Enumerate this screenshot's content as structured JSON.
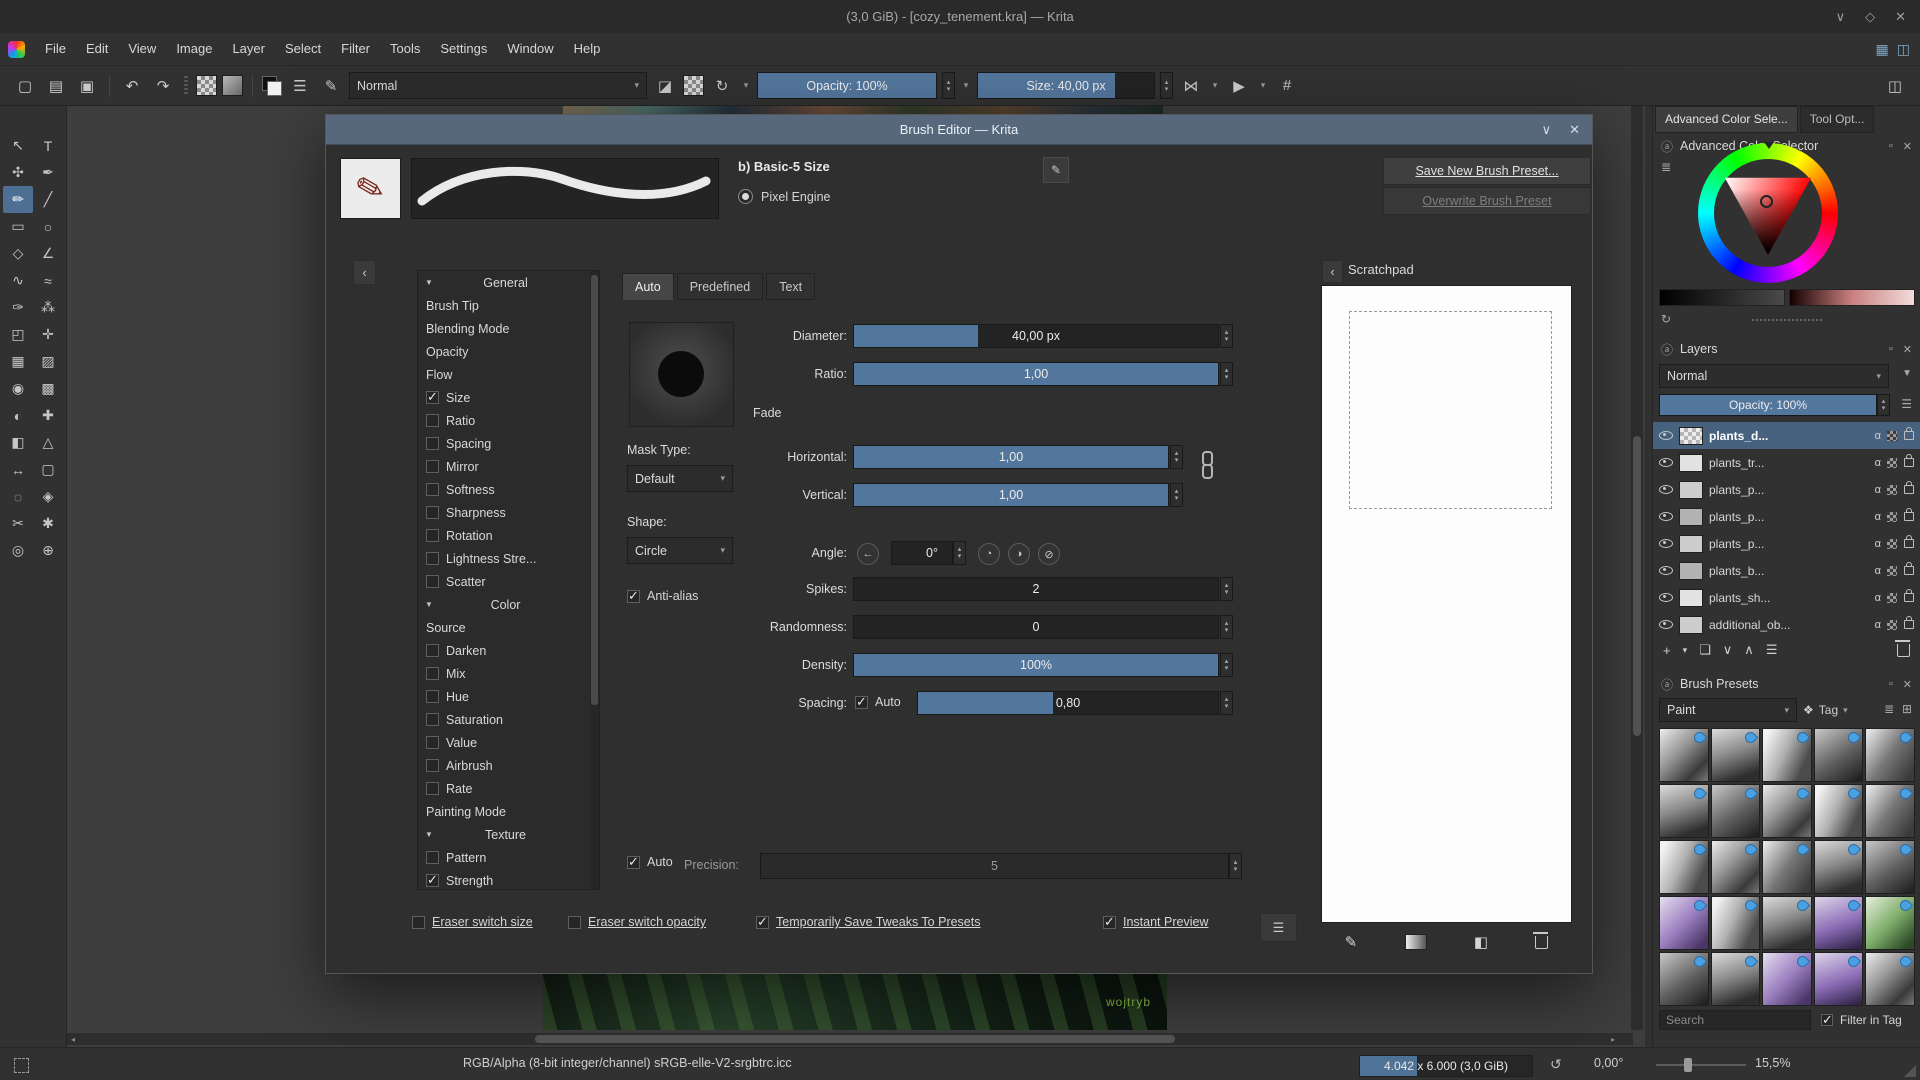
{
  "window": {
    "title": "(3,0 GiB) - [cozy_tenement.kra] — Krita"
  },
  "icons": {
    "minimize": "∨",
    "maximize": "◇",
    "close": "✕",
    "new": "▢",
    "open": "▤",
    "save": "▣",
    "undo": "↶",
    "redo": "↷",
    "eraser": "◪",
    "reload": "↻",
    "mirror_h": "⋈",
    "mirror_v": "▶",
    "crop": "#",
    "panel": "◫",
    "workspace_a": "▦",
    "workspace_b": "◫",
    "collapse": "‹",
    "edit": "✎",
    "menu": "☰",
    "brush": "✎",
    "angle_dial": "←",
    "angle_a": "◔",
    "angle_b": "◑",
    "angle_c": "⊘",
    "badge": "ⓐ",
    "float": "▫",
    "dock_close": "✕",
    "refresh": "↻",
    "funnel": "▼",
    "list": "≣",
    "grid": "⊞",
    "tag": "❖",
    "add": "+",
    "caret": "▾",
    "duplicate": "❏",
    "down": "∨",
    "up": "∧",
    "props": "☰",
    "scratch_fill": "◧",
    "rotation": "↺",
    "alpha": "α",
    "left": "◂",
    "right": "▸",
    "up_s": "▴",
    "down_s": "▾"
  },
  "menubar": {
    "items": [
      "File",
      "Edit",
      "View",
      "Image",
      "Layer",
      "Select",
      "Filter",
      "Tools",
      "Settings",
      "Window",
      "Help"
    ]
  },
  "toolbar": {
    "blending_mode": "Normal",
    "opacity_label": "Opacity: 100%",
    "opacity_fill": 100,
    "size_label": "Size: 40,00 px",
    "size_fill": 78
  },
  "toolbox": {
    "tools": [
      {
        "name": "tool-select-shapes",
        "glyph": "↖",
        "state": "off"
      },
      {
        "name": "tool-text",
        "glyph": "T",
        "state": "off"
      },
      {
        "name": "tool-edit-shapes",
        "glyph": "✣",
        "state": "off"
      },
      {
        "name": "tool-calligraphy",
        "glyph": "✒",
        "state": "off"
      },
      {
        "name": "tool-freehand-brush",
        "glyph": "✏",
        "state": "on"
      },
      {
        "name": "tool-line",
        "glyph": "╱",
        "state": "off"
      },
      {
        "name": "tool-rectangle",
        "glyph": "▭",
        "state": "off"
      },
      {
        "name": "tool-ellipse",
        "glyph": "○",
        "state": "off"
      },
      {
        "name": "tool-polygon",
        "glyph": "◇",
        "state": "off"
      },
      {
        "name": "tool-polyline",
        "glyph": "∠",
        "state": "off"
      },
      {
        "name": "tool-bezier-curve",
        "glyph": "∿",
        "state": "off"
      },
      {
        "name": "tool-freehand-path",
        "glyph": "≈",
        "state": "off"
      },
      {
        "name": "tool-dynamic-brush",
        "glyph": "✑",
        "state": "off"
      },
      {
        "name": "tool-multibrush",
        "glyph": "⁂",
        "state": "off"
      },
      {
        "name": "tool-transform",
        "glyph": "◰",
        "state": "off"
      },
      {
        "name": "tool-move",
        "glyph": "✛",
        "state": "off"
      },
      {
        "name": "tool-crop",
        "glyph": "▦",
        "state": "off"
      },
      {
        "name": "tool-gradient",
        "glyph": "▨",
        "state": "off"
      },
      {
        "name": "tool-color-sampler",
        "glyph": "◉",
        "state": "off"
      },
      {
        "name": "tool-pattern",
        "glyph": "▩",
        "state": "off"
      },
      {
        "name": "tool-colorize-mask",
        "glyph": "◐",
        "state": "off"
      },
      {
        "name": "tool-smart-patch",
        "glyph": "✚",
        "state": "off"
      },
      {
        "name": "tool-fill",
        "glyph": "◧",
        "state": "off"
      },
      {
        "name": "tool-assistants",
        "glyph": "△",
        "state": "off"
      },
      {
        "name": "tool-measure",
        "glyph": "↔",
        "state": "off"
      },
      {
        "name": "tool-rect-select",
        "glyph": "▢",
        "state": "off"
      },
      {
        "name": "tool-ellipse-select",
        "glyph": "◌",
        "state": "off"
      },
      {
        "name": "tool-polygon-select",
        "glyph": "◈",
        "state": "off"
      },
      {
        "name": "tool-freehand-select",
        "glyph": "✂",
        "state": "off"
      },
      {
        "name": "tool-contiguous-select",
        "glyph": "✱",
        "state": "off"
      },
      {
        "name": "tool-zoom",
        "glyph": "◎",
        "state": "off"
      },
      {
        "name": "tool-pan",
        "glyph": "⊕",
        "state": "off"
      }
    ]
  },
  "canvas": {
    "signature": "wojtryb"
  },
  "dialog": {
    "title": "Brush Editor — Krita",
    "preset_name": "b) Basic-5 Size",
    "engine_label": "Pixel Engine",
    "save_button": "Save New Brush Preset...",
    "overwrite_button": "Overwrite Brush Preset",
    "options": [
      {
        "type": "header",
        "label": "General"
      },
      {
        "type": "plain",
        "label": "Brush Tip"
      },
      {
        "type": "plain",
        "label": "Blending Mode"
      },
      {
        "type": "plain",
        "label": "Opacity"
      },
      {
        "type": "plain",
        "label": "Flow"
      },
      {
        "type": "check",
        "state": "on",
        "label": "Size"
      },
      {
        "type": "check",
        "state": "off",
        "label": "Ratio"
      },
      {
        "type": "check",
        "state": "off",
        "label": "Spacing"
      },
      {
        "type": "check",
        "state": "off",
        "label": "Mirror"
      },
      {
        "type": "check",
        "state": "off",
        "label": "Softness"
      },
      {
        "type": "check",
        "state": "off",
        "label": "Sharpness"
      },
      {
        "type": "check",
        "state": "off",
        "label": "Rotation"
      },
      {
        "type": "check",
        "state": "off",
        "label": "Lightness Stre..."
      },
      {
        "type": "check",
        "state": "off",
        "label": "Scatter"
      },
      {
        "type": "header",
        "label": "Color"
      },
      {
        "type": "plain",
        "label": "Source"
      },
      {
        "type": "check",
        "state": "off",
        "label": "Darken"
      },
      {
        "type": "check",
        "state": "off",
        "label": "Mix"
      },
      {
        "type": "check",
        "state": "off",
        "label": "Hue"
      },
      {
        "type": "check",
        "state": "off",
        "label": "Saturation"
      },
      {
        "type": "check",
        "state": "off",
        "label": "Value"
      },
      {
        "type": "check",
        "state": "off",
        "label": "Airbrush"
      },
      {
        "type": "check",
        "state": "off",
        "label": "Rate"
      },
      {
        "type": "plain",
        "label": "Painting Mode"
      },
      {
        "type": "header",
        "label": "Texture"
      },
      {
        "type": "check",
        "state": "off",
        "label": "Pattern"
      },
      {
        "type": "check",
        "state": "on",
        "label": "Strength"
      }
    ],
    "tabs": [
      {
        "label": "Auto",
        "state": "on"
      },
      {
        "label": "Predefined",
        "state": "off"
      },
      {
        "label": "Text",
        "state": "off"
      }
    ],
    "fade_label": "Fade",
    "mask_type_label": "Mask Type:",
    "mask_type_value": "Default",
    "shape_label": "Shape:",
    "shape_value": "Circle",
    "angle_label": "Angle:",
    "angle_value": "0°",
    "antialias": {
      "label": "Anti-alias",
      "state": "on"
    },
    "sliders": {
      "diameter": {
        "label": "Diameter:",
        "value": "40,00 px",
        "fill": 34
      },
      "ratio": {
        "label": "Ratio:",
        "value": "1,00",
        "fill": 100
      },
      "horizontal": {
        "label": "Horizontal:",
        "value": "1,00",
        "fill": 100
      },
      "vertical": {
        "label": "Vertical:",
        "value": "1,00",
        "fill": 100
      },
      "spikes": {
        "label": "Spikes:",
        "value": "2",
        "fill": 0
      },
      "randomness": {
        "label": "Randomness:",
        "value": "0",
        "fill": 0
      },
      "density": {
        "label": "Density:",
        "value": "100%",
        "fill": 100
      },
      "spacing": {
        "label": "Spacing:",
        "value": "0,80",
        "fill": 45
      }
    },
    "spacing_auto": {
      "label": "Auto",
      "state": "on"
    },
    "auto_bottom": {
      "label": "Auto",
      "state": "on"
    },
    "precision_label": "Precision:",
    "precision_value": "5",
    "footer": [
      {
        "label": "Eraser switch size",
        "state": "off"
      },
      {
        "label": "Eraser switch opacity",
        "state": "off"
      },
      {
        "label": "Temporarily Save Tweaks To Presets",
        "state": "on"
      },
      {
        "label": "Instant Preview",
        "state": "on"
      }
    ],
    "scratchpad_title": "Scratchpad"
  },
  "docker": {
    "tabs": [
      {
        "label": "Advanced Color Sele...",
        "state": "on"
      },
      {
        "label": "Tool Opt...",
        "state": "off"
      }
    ],
    "color_selector": {
      "title": "Advanced Color Selector"
    },
    "layers": {
      "title": "Layers",
      "blending_mode": "Normal",
      "opacity_label": "Opacity: 100%",
      "opacity_fill": 100,
      "rows": [
        {
          "name": "plants_d...",
          "state": "sel",
          "thumb": "checker"
        },
        {
          "name": "plants_tr...",
          "state": "",
          "thumb": "t1"
        },
        {
          "name": "plants_p...",
          "state": "",
          "thumb": "t2"
        },
        {
          "name": "plants_p...",
          "state": "",
          "thumb": "t3"
        },
        {
          "name": "plants_p...",
          "state": "",
          "thumb": "t2"
        },
        {
          "name": "plants_b...",
          "state": "",
          "thumb": "t3"
        },
        {
          "name": "plants_sh...",
          "state": "",
          "thumb": "t1"
        },
        {
          "name": "additional_ob...",
          "state": "",
          "thumb": "t2"
        }
      ]
    },
    "presets": {
      "title": "Brush Presets",
      "category": "Paint",
      "tag_label": "Tag",
      "search_placeholder": "Search",
      "filter_label": "Filter in Tag",
      "filter_state": "on",
      "items": [
        {
          "variant": "v-g1"
        },
        {
          "variant": "v-g2"
        },
        {
          "variant": "v-g3"
        },
        {
          "variant": "v-g4"
        },
        {
          "variant": "v-g5"
        },
        {
          "variant": "v-g2"
        },
        {
          "variant": "v-g4"
        },
        {
          "variant": "v-g1"
        },
        {
          "variant": "v-g3"
        },
        {
          "variant": "v-g5"
        },
        {
          "variant": "v-g3"
        },
        {
          "variant": "v-g1"
        },
        {
          "variant": "v-g5"
        },
        {
          "variant": "v-g2"
        },
        {
          "variant": "v-g4"
        },
        {
          "variant": "v-p1"
        },
        {
          "variant": "v-g3"
        },
        {
          "variant": "v-g2"
        },
        {
          "variant": "v-p2"
        },
        {
          "variant": "v-gr"
        },
        {
          "variant": "v-g4"
        },
        {
          "variant": "v-g2"
        },
        {
          "variant": "v-p1"
        },
        {
          "variant": "v-p2"
        },
        {
          "variant": "v-g1"
        }
      ]
    }
  },
  "statusbar": {
    "color_info": "RGB/Alpha (8-bit integer/channel)  sRGB-elle-V2-srgbtrc.icc",
    "memory": "4.042 x 6.000 (3,0 GiB)",
    "memory_fill": 33,
    "rotation": "0,00°",
    "zoom": "15,5%"
  }
}
